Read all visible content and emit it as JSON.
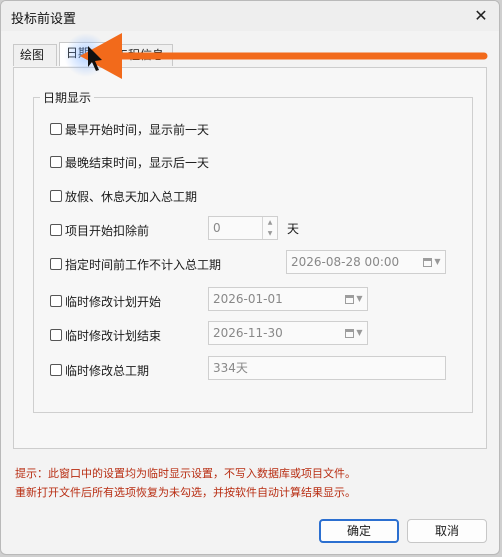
{
  "window": {
    "title": "投标前设置",
    "close_glyph": "✕"
  },
  "tabs": [
    {
      "label": "绘图"
    },
    {
      "label": "日期"
    },
    {
      "label": "工程信息"
    }
  ],
  "group": {
    "title": "日期显示",
    "options": [
      {
        "label": "最早开始时间，显示前一天",
        "checked": false
      },
      {
        "label": "最晚结束时间，显示后一天",
        "checked": false
      },
      {
        "label": "放假、休息天加入总工期",
        "checked": false
      },
      {
        "label": "项目开始扣除前",
        "checked": false,
        "value": "0",
        "unit": "天"
      },
      {
        "label": "指定时间前工作不计入总工期",
        "checked": false,
        "value": "2026-08-28 00:00"
      },
      {
        "label": "临时修改计划开始",
        "checked": false,
        "value": "2026-01-01"
      },
      {
        "label": "临时修改计划结束",
        "checked": false,
        "value": "2026-11-30"
      },
      {
        "label": "临时修改总工期",
        "checked": false,
        "value": "334天"
      }
    ]
  },
  "hint": {
    "line1": "提示：此窗口中的设置均为临时显示设置，不写入数据库或项目文件。",
    "line2": "重新打开文件后所有选项恢复为未勾选，并按软件自动计算结果显示。"
  },
  "buttons": {
    "ok": "确定",
    "cancel": "取消"
  },
  "colors": {
    "annotation_arrow": "#f26a1b",
    "hint_text": "#b82d12",
    "primary_border": "#2b6fd0"
  }
}
